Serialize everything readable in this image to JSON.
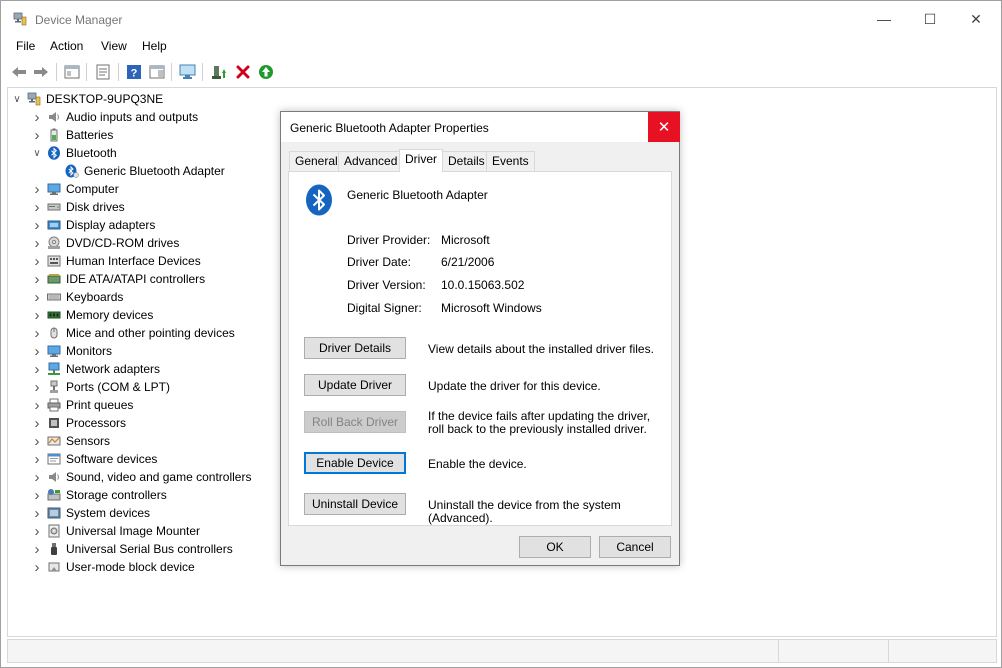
{
  "window": {
    "title": "Device Manager",
    "minimize": "—",
    "maximize": "☐",
    "close": "✕"
  },
  "menu": [
    "File",
    "Action",
    "View",
    "Help"
  ],
  "tree": {
    "root": "DESKTOP-9UPQ3NE",
    "items": [
      {
        "label": "Audio inputs and outputs",
        "icon": "speaker-icon",
        "expanded": false
      },
      {
        "label": "Batteries",
        "icon": "battery-icon",
        "expanded": false
      },
      {
        "label": "Bluetooth",
        "icon": "bluetooth-icon",
        "expanded": true
      },
      {
        "label": "Generic Bluetooth Adapter",
        "icon": "bluetooth-device-icon",
        "child": true
      },
      {
        "label": "Computer",
        "icon": "monitor-icon",
        "expanded": false
      },
      {
        "label": "Disk drives",
        "icon": "disk-drive-icon",
        "expanded": false
      },
      {
        "label": "Display adapters",
        "icon": "display-adapter-icon",
        "expanded": false
      },
      {
        "label": "DVD/CD-ROM drives",
        "icon": "dvd-drive-icon",
        "expanded": false
      },
      {
        "label": "Human Interface Devices",
        "icon": "hid-icon",
        "expanded": false
      },
      {
        "label": "IDE ATA/ATAPI controllers",
        "icon": "ide-controller-icon",
        "expanded": false
      },
      {
        "label": "Keyboards",
        "icon": "keyboard-icon",
        "expanded": false
      },
      {
        "label": "Memory devices",
        "icon": "memory-icon",
        "expanded": false
      },
      {
        "label": "Mice and other pointing devices",
        "icon": "mouse-icon",
        "expanded": false
      },
      {
        "label": "Monitors",
        "icon": "monitor-icon",
        "expanded": false
      },
      {
        "label": "Network adapters",
        "icon": "network-icon",
        "expanded": false
      },
      {
        "label": "Ports (COM & LPT)",
        "icon": "port-icon",
        "expanded": false
      },
      {
        "label": "Print queues",
        "icon": "printer-icon",
        "expanded": false
      },
      {
        "label": "Processors",
        "icon": "processor-icon",
        "expanded": false
      },
      {
        "label": "Sensors",
        "icon": "sensor-icon",
        "expanded": false
      },
      {
        "label": "Software devices",
        "icon": "software-device-icon",
        "expanded": false
      },
      {
        "label": "Sound, video and game controllers",
        "icon": "speaker-icon",
        "expanded": false
      },
      {
        "label": "Storage controllers",
        "icon": "storage-controller-icon",
        "expanded": false
      },
      {
        "label": "System devices",
        "icon": "system-device-icon",
        "expanded": false
      },
      {
        "label": "Universal Image Mounter",
        "icon": "image-mounter-icon",
        "expanded": false
      },
      {
        "label": "Universal Serial Bus controllers",
        "icon": "usb-icon",
        "expanded": false
      },
      {
        "label": "User-mode block device",
        "icon": "block-device-icon",
        "expanded": false
      }
    ]
  },
  "dialog": {
    "title": "Generic Bluetooth Adapter Properties",
    "close": "✕",
    "tabs": [
      "General",
      "Advanced",
      "Driver",
      "Details",
      "Events"
    ],
    "active_tab": "Driver",
    "device_name": "Generic Bluetooth Adapter",
    "fields": [
      {
        "label": "Driver Provider:",
        "value": "Microsoft"
      },
      {
        "label": "Driver Date:",
        "value": "6/21/2006"
      },
      {
        "label": "Driver Version:",
        "value": "10.0.15063.502"
      },
      {
        "label": "Digital Signer:",
        "value": "Microsoft Windows"
      }
    ],
    "actions": [
      {
        "label": "Driver Details",
        "desc": "View details about the installed driver files.",
        "disabled": false,
        "focused": false
      },
      {
        "label": "Update Driver",
        "desc": "Update the driver for this device.",
        "disabled": false,
        "focused": false
      },
      {
        "label": "Roll Back Driver",
        "desc": "If the device fails after updating the driver, roll back to the previously installed driver.",
        "disabled": true,
        "focused": false
      },
      {
        "label": "Enable Device",
        "desc": "Enable the device.",
        "disabled": false,
        "focused": true
      },
      {
        "label": "Uninstall Device",
        "desc": "Uninstall the device from the system (Advanced).",
        "disabled": false,
        "focused": false
      }
    ],
    "ok": "OK",
    "cancel": "Cancel"
  },
  "colors": {
    "accent": "#0078d7",
    "close_red": "#e81123",
    "bluetooth_blue": "#1565c0"
  }
}
